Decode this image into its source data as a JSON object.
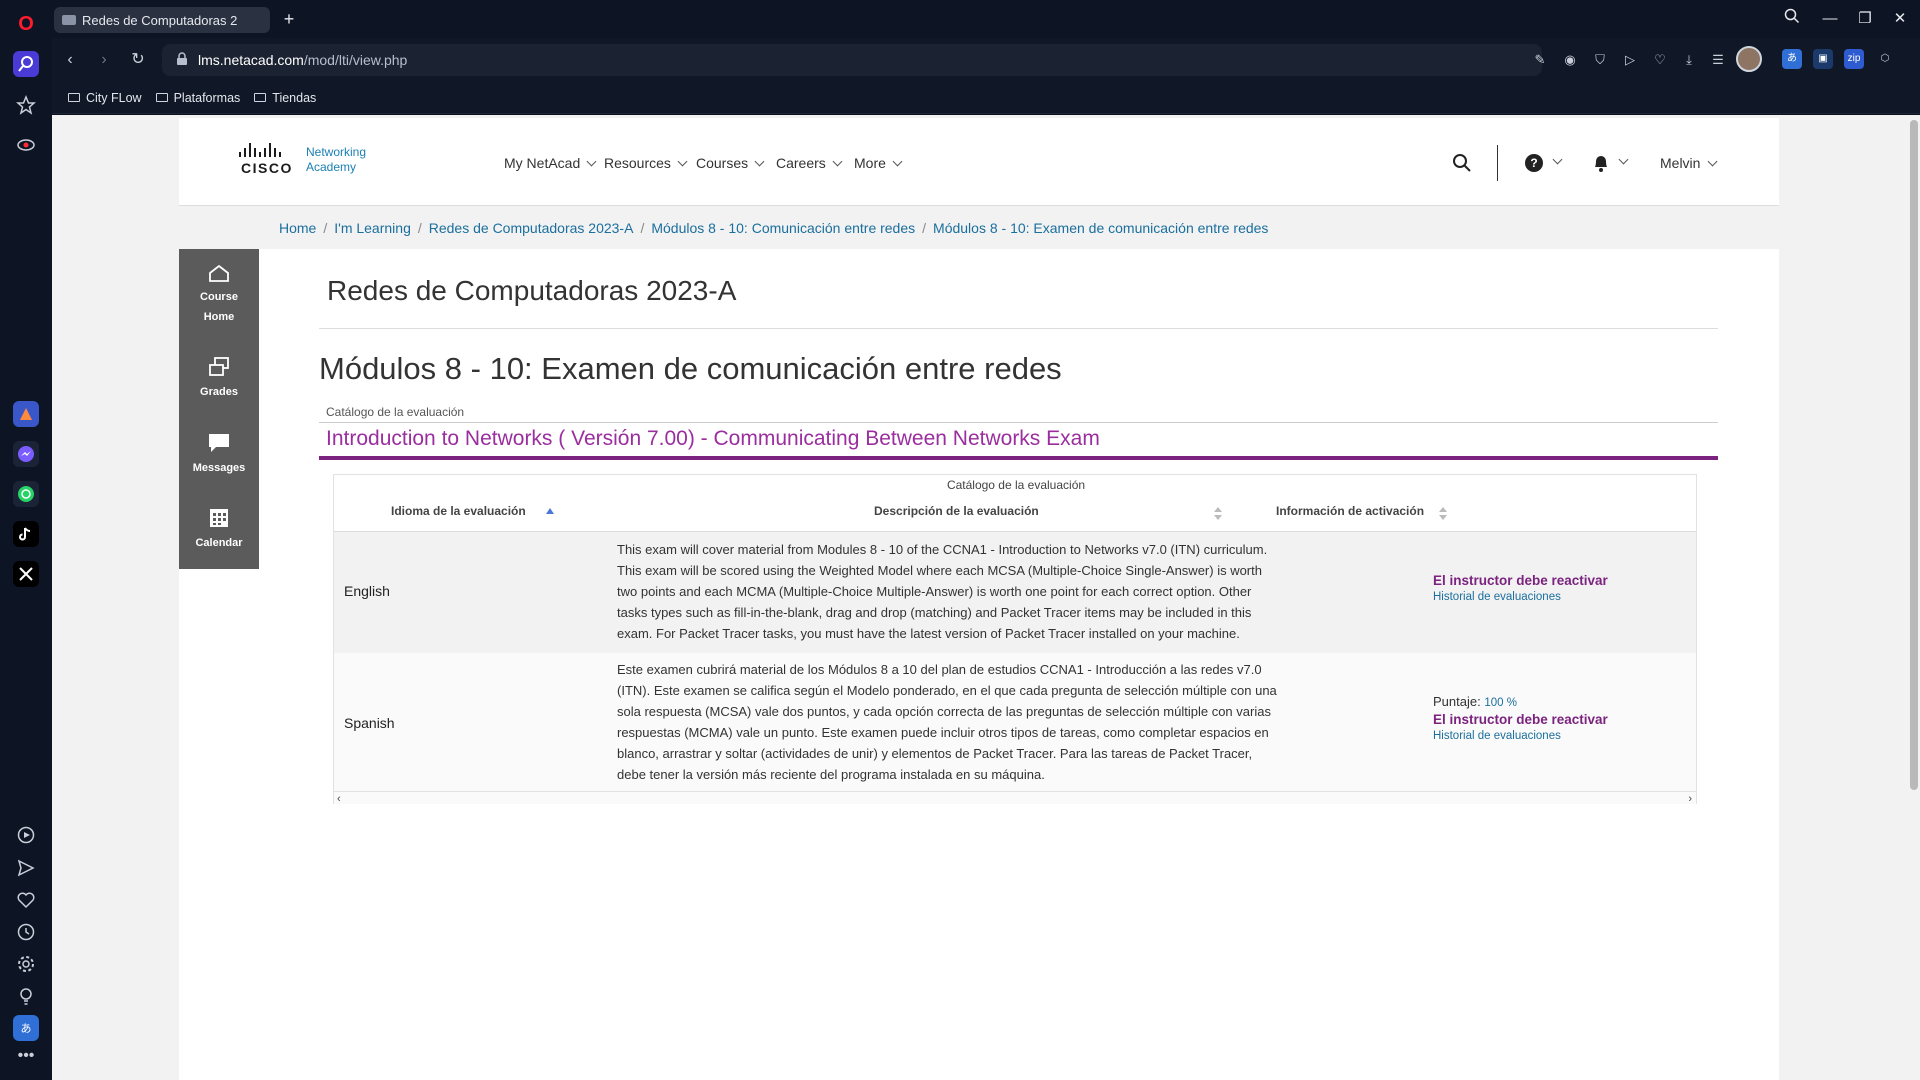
{
  "browser": {
    "tab_title": "Redes de Computadoras 2",
    "url_host": "lms.netacad.com",
    "url_path": "/mod/lti/view.php",
    "bookmarks": [
      "City FLow",
      "Plataformas",
      "Tiendas"
    ]
  },
  "header": {
    "logo_word": "CISCO",
    "logo_sub_line1": "Networking",
    "logo_sub_line2": "Academy",
    "nav": [
      "My NetAcad",
      "Resources",
      "Courses",
      "Careers",
      "More"
    ],
    "user_name": "Melvin"
  },
  "breadcrumb": [
    "Home",
    "I'm Learning",
    "Redes de Computadoras 2023-A",
    "Módulos 8 - 10: Comunicación entre redes",
    "Módulos 8 - 10: Examen de comunicación entre redes"
  ],
  "left_nav": {
    "course_home_line1": "Course",
    "course_home_line2": "Home",
    "grades": "Grades",
    "messages": "Messages",
    "calendar": "Calendar"
  },
  "main": {
    "course_title": "Redes de Computadoras 2023-A",
    "exam_title": "Módulos 8 - 10: Examen de comunicación entre redes",
    "catalog_label": "Catálogo de la evaluación",
    "catalog_title": "Introduction to Networks ( Versión 7.00) - Communicating Between Networks Exam"
  },
  "table": {
    "caption": "Catálogo de la evaluación",
    "headers": [
      "Idioma de la evaluación",
      "Descripción de la evaluación",
      "Información de activación"
    ],
    "rows": [
      {
        "language": "English",
        "description": "This exam will cover material from Modules 8 - 10 of the CCNA1 - Introduction to Networks v7.0 (ITN) curriculum. This exam will be scored using the Weighted Model where each MCSA (Multiple-Choice Single-Answer) is worth two points and each MCMA (Multiple-Choice Multiple-Answer) is worth one point for each correct option. Other tasks types such as fill-in-the-blank, drag and drop (matching) and Packet Tracer items may be included in this exam. For Packet Tracer tasks, you must have the latest version of Packet Tracer installed on your machine.",
        "status": "El instructor debe reactivar",
        "history_link": "Historial de evaluaciones"
      },
      {
        "language": "Spanish",
        "description": "Este examen cubrirá material de los Módulos 8 a 10 del plan de estudios CCNA1 - Introducción a las redes v7.0 (ITN). Este examen se califica según el Modelo ponderado, en el que cada pregunta de selección múltiple con una sola respuesta (MCSA) vale dos puntos, y cada opción correcta de las preguntas de selección múltiple con varias respuestas (MCMA) vale un punto. Este examen puede incluir otros tipos de tareas, como completar espacios en blanco, arrastrar y soltar (actividades de unir) y elementos de Packet Tracer. Para las tareas de Packet Tracer, debe tener la versión más reciente del programa instalada en su máquina.",
        "score_label": "Puntaje:",
        "score_value": "100 %",
        "status": "El instructor debe reactivar",
        "history_link": "Historial de evaluaciones"
      }
    ]
  },
  "colors": {
    "accent_purple": "#7b237f",
    "link_blue": "#1b6f9e",
    "sidebar_gray": "#5b5b5b"
  }
}
